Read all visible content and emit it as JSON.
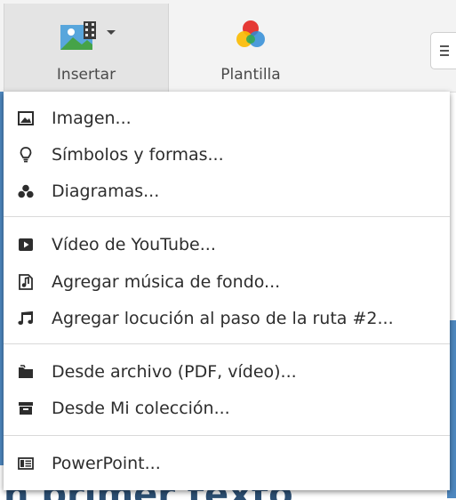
{
  "toolbar": {
    "insert": {
      "label": "Insertar",
      "icon": "media-insert-icon"
    },
    "template": {
      "label": "Plantilla",
      "icon": "color-palette-icon"
    },
    "extra": {
      "icon": "menu-lines-icon"
    }
  },
  "background": {
    "slide_text": "n primer texto",
    "slide_color": "#4e88c0"
  },
  "menu": {
    "groups": [
      [
        {
          "label": "Imagen...",
          "icon": "image-icon"
        },
        {
          "label": "Símbolos y formas...",
          "icon": "lightbulb-icon"
        },
        {
          "label": "Diagramas...",
          "icon": "diagram-icon"
        }
      ],
      [
        {
          "label": "Vídeo de YouTube...",
          "icon": "play-icon"
        },
        {
          "label": "Agregar música de fondo...",
          "icon": "music-file-icon"
        },
        {
          "label": "Agregar locución al paso de la ruta #2...",
          "icon": "music-note-icon"
        }
      ],
      [
        {
          "label": "Desde archivo (PDF, vídeo)...",
          "icon": "folder-icon"
        },
        {
          "label": "Desde Mi colección...",
          "icon": "archive-icon"
        }
      ],
      [
        {
          "label": "PowerPoint...",
          "icon": "powerpoint-icon"
        }
      ]
    ]
  }
}
